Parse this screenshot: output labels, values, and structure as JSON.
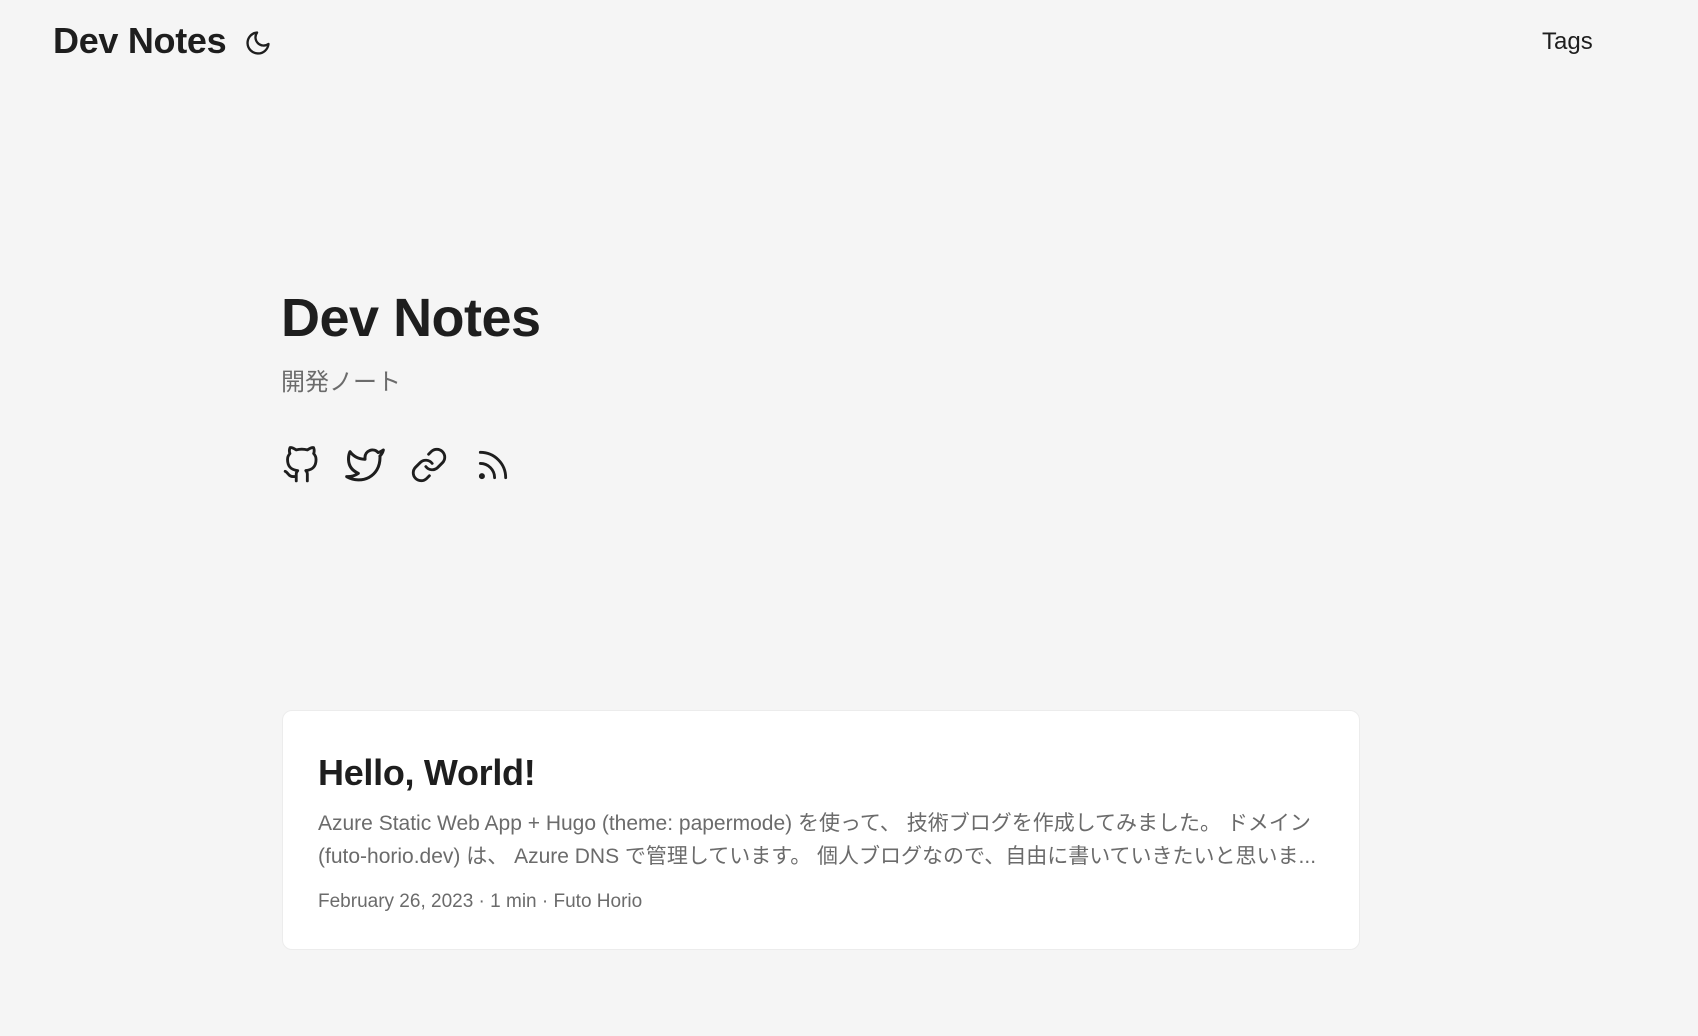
{
  "header": {
    "logo": "Dev Notes",
    "theme_toggle_icon": "moon-icon",
    "nav": {
      "tags_label": "Tags"
    }
  },
  "hero": {
    "title": "Dev Notes",
    "subtitle": "開発ノート",
    "social_icons": [
      "github-icon",
      "twitter-icon",
      "link-icon",
      "rss-icon"
    ]
  },
  "posts": [
    {
      "title": "Hello, World!",
      "summary": "Azure Static Web App + Hugo (theme: papermode) を使って、 技術ブログを作成してみました。 ドメイン (futo-horio.dev) は、 Azure DNS で管理しています。 個人ブログなので、自由に書いていきたいと思いま...",
      "meta": "February 26, 2023 · 1 min · Futo Horio"
    }
  ],
  "colors": {
    "background": "#f5f5f5",
    "card": "#ffffff",
    "primary_text": "#1e1e1e",
    "secondary_text": "#6b6b6b",
    "card_border": "#ececec"
  }
}
